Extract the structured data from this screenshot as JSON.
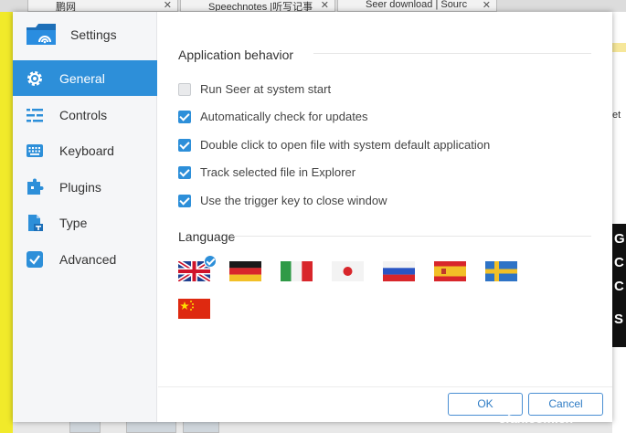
{
  "browser": {
    "tabs": [
      {
        "label": "鹏网"
      },
      {
        "label": "Speechnotes |听写记事"
      },
      {
        "label": "Seer download | Sourc"
      }
    ],
    "right_text": "et",
    "right_letters": [
      "G",
      "C",
      "C",
      "S"
    ],
    "watermark": "cfan.com.cn"
  },
  "dialog": {
    "title": "Settings",
    "nav": [
      {
        "label": "General",
        "icon": "gear-icon",
        "active": true
      },
      {
        "label": "Controls",
        "icon": "sliders-icon",
        "active": false
      },
      {
        "label": "Keyboard",
        "icon": "keyboard-icon",
        "active": false
      },
      {
        "label": "Plugins",
        "icon": "puzzle-icon",
        "active": false
      },
      {
        "label": "Type",
        "icon": "file-type-icon",
        "active": false
      },
      {
        "label": "Advanced",
        "icon": "checkbox-icon",
        "active": false
      }
    ],
    "app_behavior": {
      "title": "Application behavior",
      "options": [
        {
          "label": "Run Seer at system start",
          "checked": false
        },
        {
          "label": "Automatically check for updates",
          "checked": true
        },
        {
          "label": "Double click to open file with system default application",
          "checked": true
        },
        {
          "label": "Track selected file in Explorer",
          "checked": true
        },
        {
          "label": "Use the trigger key to close window",
          "checked": true
        }
      ]
    },
    "language": {
      "title": "Language",
      "flags": [
        {
          "name": "uk-flag",
          "selected": true
        },
        {
          "name": "germany-flag",
          "selected": false
        },
        {
          "name": "italy-flag",
          "selected": false
        },
        {
          "name": "japan-flag",
          "selected": false
        },
        {
          "name": "russia-flag",
          "selected": false
        },
        {
          "name": "spain-flag",
          "selected": false
        },
        {
          "name": "sweden-flag",
          "selected": false
        },
        {
          "name": "china-flag",
          "selected": false
        }
      ]
    },
    "buttons": {
      "ok": "OK",
      "cancel": "Cancel"
    },
    "colors": {
      "accent": "#2d8fd9",
      "sidebar": "#f5f6f8"
    }
  }
}
